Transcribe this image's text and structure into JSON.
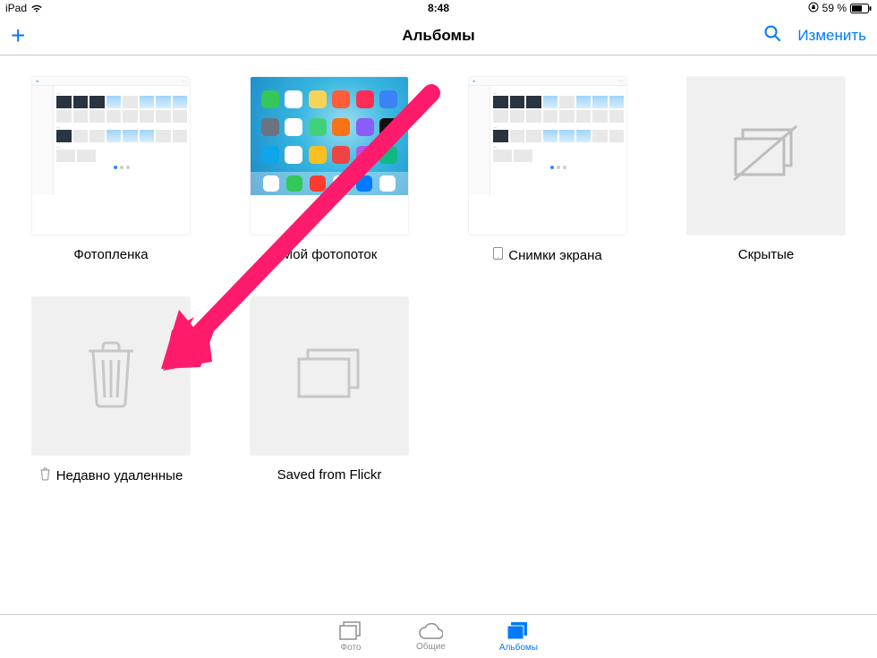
{
  "status": {
    "device": "iPad",
    "time": "8:48",
    "lock_icon": "lock-icon",
    "battery_text": "59 %"
  },
  "navbar": {
    "title": "Альбомы",
    "add_label": "+",
    "search_label": "Поиск",
    "edit_label": "Изменить"
  },
  "albums": [
    {
      "key": "camera_roll",
      "label": "Фотопленка",
      "thumb": "screenshot",
      "prefix_icon": null
    },
    {
      "key": "photostream",
      "label": "Мой фотопоток",
      "thumb": "home",
      "prefix_icon": null
    },
    {
      "key": "screenshots",
      "label": "Снимки экрана",
      "thumb": "screenshot",
      "prefix_icon": "ipad-icon"
    },
    {
      "key": "hidden",
      "label": "Скрытые",
      "thumb": "hidden",
      "prefix_icon": null
    },
    {
      "key": "recently_deleted",
      "label": "Недавно удаленные",
      "thumb": "trash",
      "prefix_icon": "trash-icon"
    },
    {
      "key": "flickr",
      "label": "Saved from Flickr",
      "thumb": "stack",
      "prefix_icon": null
    }
  ],
  "tabs": {
    "photos": "Фото",
    "shared": "Общие",
    "albums": "Альбомы"
  }
}
